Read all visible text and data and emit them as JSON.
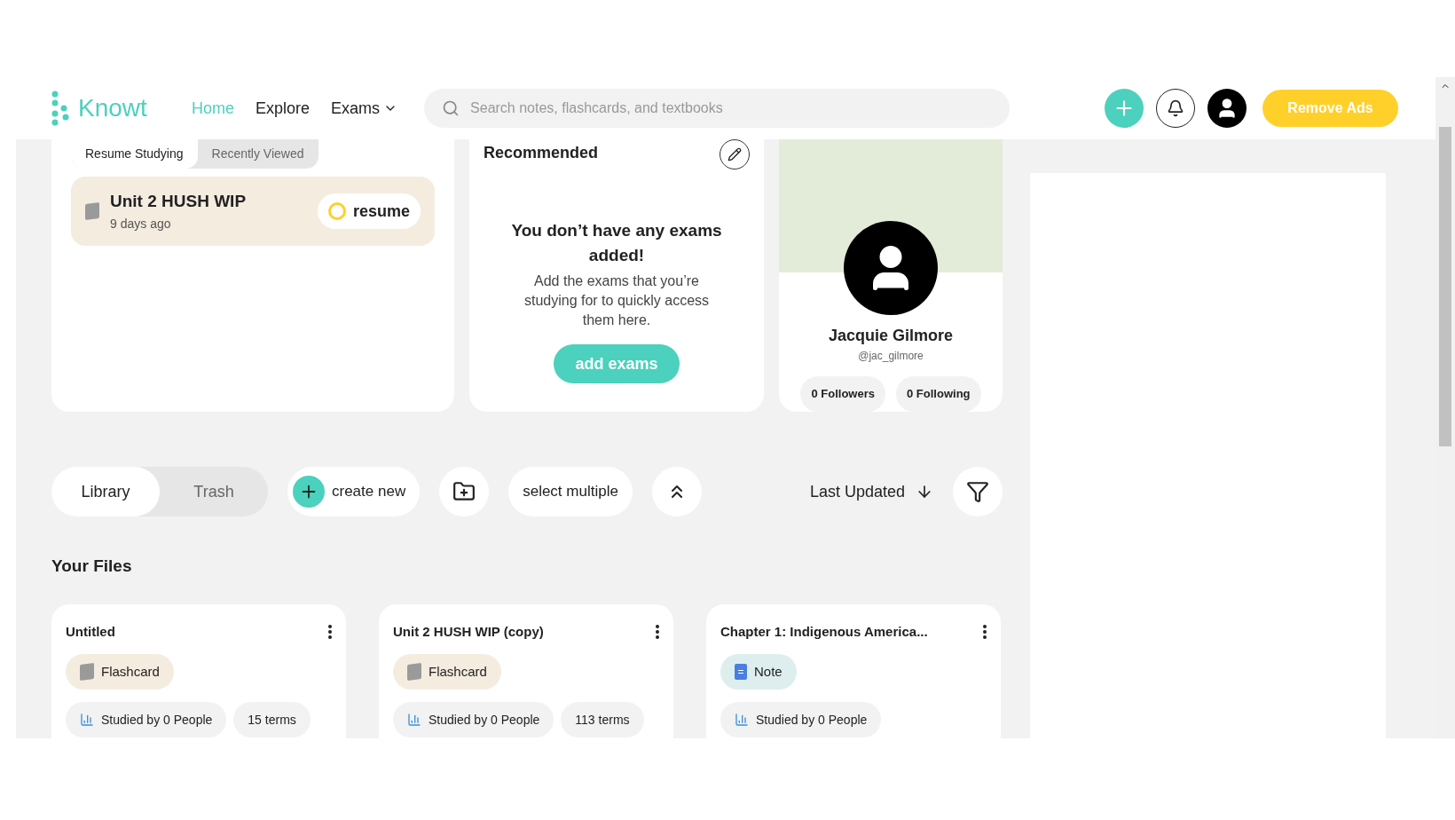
{
  "header": {
    "logo": "Knowt",
    "nav": [
      {
        "label": "Home",
        "selected": true
      },
      {
        "label": "Explore",
        "selected": false
      },
      {
        "label": "Exams",
        "selected": false,
        "dropdown": true
      }
    ],
    "search": {
      "placeholder": "Search notes, flashcards, and textbooks"
    },
    "remove_ads": "Remove Ads"
  },
  "study_tabs": [
    {
      "label": "Resume Studying",
      "selected": true
    },
    {
      "label": "Recently Viewed",
      "selected": false
    }
  ],
  "resume_item": {
    "title": "Unit 2 HUSH WIP",
    "time": "9 days ago",
    "button": "resume"
  },
  "recommended": {
    "title": "Recommended",
    "heading": "You don’t have any exams added!",
    "text": "Add the exams that you’re studying for to quickly access them here.",
    "button": "add exams"
  },
  "profile": {
    "name": "Jacquie Gilmore",
    "handle": "@jac_gilmore",
    "followers": "0 Followers",
    "following": "0 Following"
  },
  "library_tabs": [
    {
      "label": "Library",
      "selected": true
    },
    {
      "label": "Trash",
      "selected": false
    }
  ],
  "toolbar": {
    "create": "create new",
    "select": "select multiple",
    "sort": "Last Updated"
  },
  "files_title": "Your Files",
  "files": [
    {
      "title": "Untitled",
      "kind": "flashcard",
      "type_label": "Flashcard",
      "studied": "Studied by 0 People",
      "terms": "15 terms"
    },
    {
      "title": "Unit 2 HUSH WIP (copy)",
      "kind": "flashcard",
      "type_label": "Flashcard",
      "studied": "Studied by 0 People",
      "terms": "113 terms"
    },
    {
      "title": "Chapter 1: Indigenous America...",
      "kind": "note",
      "type_label": "Note",
      "studied": "Studied by 0 People"
    }
  ]
}
